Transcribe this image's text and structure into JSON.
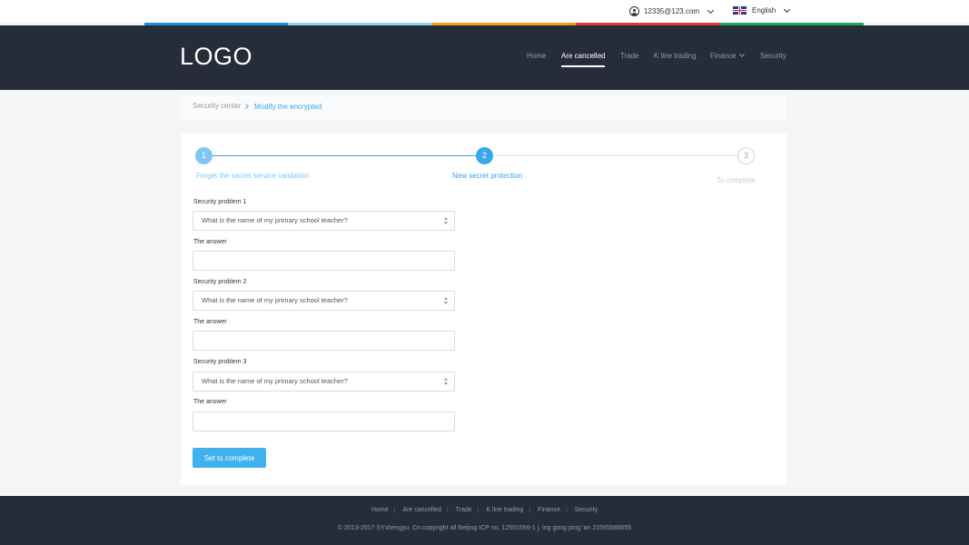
{
  "topbar": {
    "user_email": "12335@123.com",
    "language": "English",
    "strip_colors": [
      "#1f8ce0",
      "#8fd3f5",
      "#f39c12",
      "#e23a3a",
      "#1fa84f"
    ]
  },
  "header": {
    "logo": "LOGO",
    "nav": [
      {
        "label": "Home"
      },
      {
        "label": "Are cancelled"
      },
      {
        "label": "Trade"
      },
      {
        "label": "K line trading"
      },
      {
        "label": "Finance"
      },
      {
        "label": "Security"
      }
    ]
  },
  "breadcrumb": {
    "root": "Security center",
    "current": "Modify the encrypted"
  },
  "steps": [
    {
      "num": "1",
      "label": "Forget the secret service validation",
      "state": "done"
    },
    {
      "num": "2",
      "label": "New secret protection",
      "state": "active"
    },
    {
      "num": "3",
      "label": "To complete",
      "state": "pending"
    }
  ],
  "form": {
    "questions": [
      {
        "label": "Security problem 1",
        "selected": "What is the name of my primary school teacher?",
        "answer_label": "The answer",
        "answer": ""
      },
      {
        "label": "Security problem 2",
        "selected": "What is the name of my primary school teacher?",
        "answer_label": "The answer",
        "answer": ""
      },
      {
        "label": "Security problem 3",
        "selected": "What is the name of my primary school teacher?",
        "answer_label": "The answer",
        "answer": ""
      }
    ],
    "submit_label": "Set to complete"
  },
  "footer": {
    "links": [
      "Home",
      "Are cancelled",
      "Trade",
      "K line trading",
      "Finance",
      "Security"
    ],
    "copyright": "© 2013-2017 SYshengyu. Cn   copyright all Beijing ICP no. 12501556-1 j. ing gong ping 'an 21565588555"
  },
  "colors": {
    "accent": "#3aa7e8",
    "header_bg": "#272c3b",
    "button": "#3fb1ee"
  }
}
